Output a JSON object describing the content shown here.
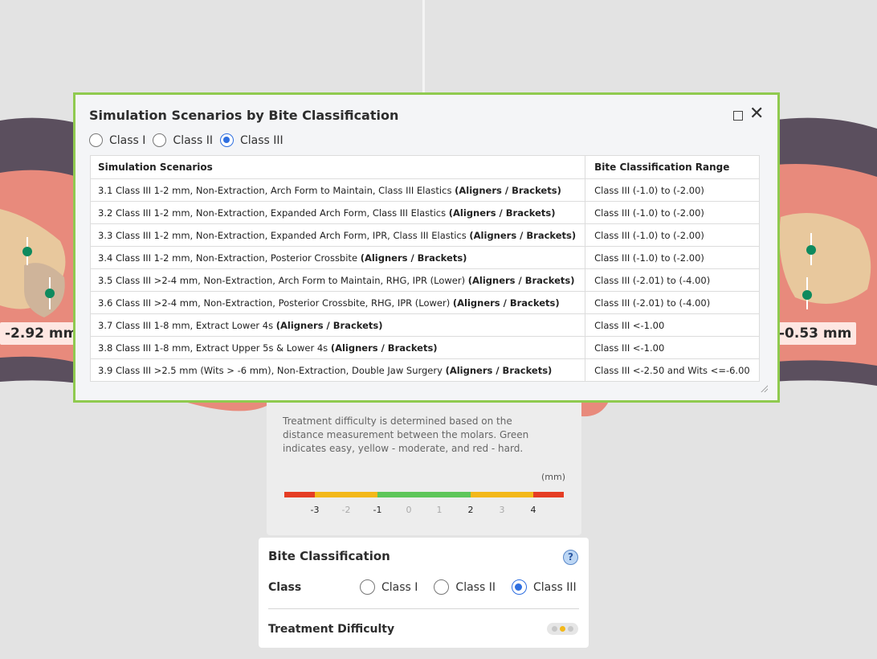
{
  "measurements": {
    "left": "-2.92 mm",
    "right": "-0.53 mm"
  },
  "dialog": {
    "title": "Simulation Scenarios by Bite Classification",
    "radios": [
      {
        "label": "Class I",
        "checked": false
      },
      {
        "label": "Class II",
        "checked": false
      },
      {
        "label": "Class III",
        "checked": true
      }
    ],
    "columns": [
      "Simulation Scenarios",
      "Bite Classification Range"
    ],
    "rows": [
      {
        "scenario": "3.1 Class III 1-2 mm, Non-Extraction, Arch Form to Maintain, Class III Elastics",
        "tag": "(Aligners / Brackets)",
        "range": "Class III (-1.0) to (-2.00)"
      },
      {
        "scenario": "3.2 Class III 1-2 mm, Non-Extraction, Expanded Arch Form, Class III Elastics",
        "tag": "(Aligners / Brackets)",
        "range": "Class III (-1.0) to (-2.00)"
      },
      {
        "scenario": "3.3 Class III 1-2 mm, Non-Extraction, Expanded Arch Form, IPR, Class III Elastics",
        "tag": "(Aligners / Brackets)",
        "range": "Class III (-1.0) to (-2.00)"
      },
      {
        "scenario": "3.4 Class III 1-2 mm, Non-Extraction, Posterior Crossbite",
        "tag": "(Aligners / Brackets)",
        "range": "Class III (-1.0) to (-2.00)"
      },
      {
        "scenario": "3.5 Class III >2-4 mm, Non-Extraction, Arch Form to Maintain, RHG, IPR (Lower)",
        "tag": "(Aligners / Brackets)",
        "range": "Class III (-2.01) to (-4.00)"
      },
      {
        "scenario": "3.6 Class III >2-4 mm, Non-Extraction, Posterior Crossbite, RHG, IPR (Lower)",
        "tag": "(Aligners / Brackets)",
        "range": "Class III (-2.01) to (-4.00)"
      },
      {
        "scenario": "3.7 Class III 1-8 mm, Extract Lower 4s",
        "tag": "(Aligners / Brackets)",
        "range": "Class III <-1.00"
      },
      {
        "scenario": "3.8 Class III 1-8 mm, Extract Upper 5s & Lower 4s",
        "tag": "(Aligners / Brackets)",
        "range": "Class III <-1.00"
      },
      {
        "scenario": "3.9 Class III >2.5 mm (Wits > -6 mm), Non-Extraction, Double Jaw Surgery",
        "tag": "(Aligners / Brackets)",
        "range": "Class III <-2.50 and Wits <=-6.00"
      }
    ]
  },
  "difficulty_info": {
    "text": "Treatment difficulty is determined based on the distance measurement between the molars. Green indicates easy, yellow - moderate, and red - hard.",
    "unit": "(mm)",
    "ticks": [
      "-3",
      "-2",
      "-1",
      "0",
      "1",
      "2",
      "3",
      "4"
    ],
    "colors": {
      "red": "#e53d24",
      "yellow": "#f3b81a",
      "green": "#5ec65a"
    }
  },
  "bite_panel": {
    "title": "Bite Classification",
    "help": "?",
    "class_label": "Class",
    "radios": [
      {
        "label": "Class I",
        "checked": false
      },
      {
        "label": "Class II",
        "checked": false
      },
      {
        "label": "Class III",
        "checked": true
      }
    ],
    "difficulty_label": "Treatment Difficulty",
    "difficulty_level": "moderate"
  }
}
